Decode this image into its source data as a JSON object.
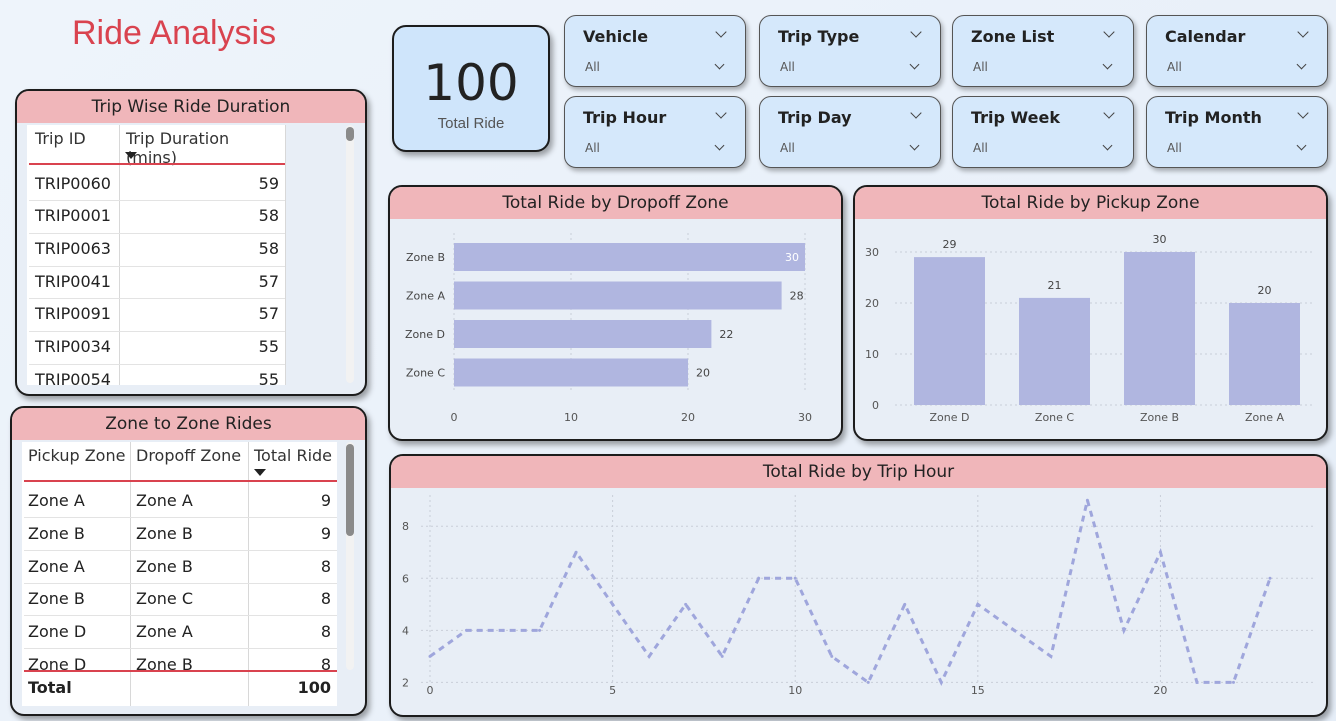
{
  "title": "Ride Analysis",
  "kpi": {
    "value": "100",
    "label": "Total Ride"
  },
  "slicers": [
    {
      "title": "Vehicle",
      "value": "All"
    },
    {
      "title": "Trip Type",
      "value": "All"
    },
    {
      "title": "Zone List",
      "value": "All"
    },
    {
      "title": "Calendar",
      "value": "All"
    },
    {
      "title": "Trip Hour",
      "value": "All"
    },
    {
      "title": "Trip Day",
      "value": "All"
    },
    {
      "title": "Trip Week",
      "value": "All"
    },
    {
      "title": "Trip Month",
      "value": "All"
    }
  ],
  "trip_table": {
    "title": "Trip Wise Ride Duration",
    "columns": [
      "Trip ID",
      "Trip Duration (mins)"
    ],
    "rows": [
      [
        "TRIP0060",
        "59"
      ],
      [
        "TRIP0001",
        "58"
      ],
      [
        "TRIP0063",
        "58"
      ],
      [
        "TRIP0041",
        "57"
      ],
      [
        "TRIP0091",
        "57"
      ],
      [
        "TRIP0034",
        "55"
      ],
      [
        "TRIP0054",
        "55"
      ]
    ]
  },
  "zone_table": {
    "title": "Zone to Zone Rides",
    "columns": [
      "Pickup Zone",
      "Dropoff Zone",
      "Total Ride"
    ],
    "rows": [
      [
        "Zone A",
        "Zone A",
        "9"
      ],
      [
        "Zone B",
        "Zone B",
        "9"
      ],
      [
        "Zone A",
        "Zone B",
        "8"
      ],
      [
        "Zone B",
        "Zone C",
        "8"
      ],
      [
        "Zone D",
        "Zone A",
        "8"
      ],
      [
        "Zone D",
        "Zone B",
        "8"
      ]
    ],
    "total_label": "Total",
    "total_value": "100"
  },
  "bar_color": "#b0b6e0",
  "accent_red": "#d9434f",
  "header_pink": "#f0b6ba",
  "chart_data": [
    {
      "type": "bar",
      "orientation": "horizontal",
      "title": "Total Ride by Dropoff Zone",
      "categories": [
        "Zone B",
        "Zone A",
        "Zone D",
        "Zone C"
      ],
      "values": [
        30,
        28,
        22,
        20
      ],
      "xlim": [
        0,
        30
      ],
      "xticks": [
        0,
        10,
        20,
        30
      ]
    },
    {
      "type": "bar",
      "orientation": "vertical",
      "title": "Total Ride by Pickup Zone",
      "categories": [
        "Zone D",
        "Zone C",
        "Zone B",
        "Zone A"
      ],
      "values": [
        29,
        21,
        30,
        20
      ],
      "ylim": [
        0,
        30
      ],
      "yticks": [
        0,
        10,
        20,
        30
      ]
    },
    {
      "type": "line",
      "title": "Total Ride by Trip Hour",
      "x": [
        0,
        1,
        2,
        3,
        4,
        5,
        6,
        7,
        8,
        9,
        10,
        11,
        12,
        13,
        14,
        15,
        16,
        17,
        18,
        19,
        20,
        21,
        22,
        23
      ],
      "values": [
        3,
        4,
        4,
        4,
        7,
        5,
        3,
        5,
        3,
        6,
        6,
        3,
        2,
        5,
        2,
        5,
        4,
        3,
        9,
        4,
        7,
        2,
        2,
        6
      ],
      "xlim": [
        0,
        23
      ],
      "ylim": [
        2,
        9
      ],
      "xticks": [
        0,
        5,
        10,
        15,
        20
      ],
      "yticks": [
        2,
        4,
        6,
        8
      ],
      "line_style": "dashed"
    }
  ]
}
